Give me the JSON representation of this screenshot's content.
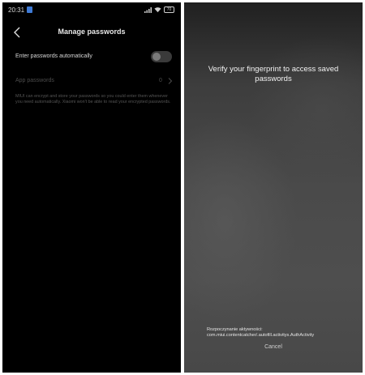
{
  "status_bar": {
    "time": "20:31",
    "battery": "70"
  },
  "manage": {
    "title": "Manage passwords",
    "auto_fill_label": "Enter passwords automatically",
    "auto_fill_enabled": false,
    "app_passwords_label": "App passwords",
    "app_passwords_count": "0",
    "description": "MIUI can encrypt and store your passwords so you could enter them whenever you need automatically. Xiaomi won't be able to read your encrypted passwords."
  },
  "auth": {
    "title": "Verify your fingerprint to access saved passwords",
    "activity_line1": "Rozpoczynanie aktywności:",
    "activity_line2": "com.miui.contentcatcher/.autofill.activitys.AuthActivity",
    "cancel_label": "Cancel"
  },
  "icons": {
    "back": "chevron-left-icon",
    "notification": "notification-badge-icon",
    "signal": "signal-icon",
    "wifi": "wifi-icon",
    "battery": "battery-icon",
    "chevron": "chevron-right-icon"
  },
  "colors": {
    "background_dark": "#000000",
    "text_primary": "#e8e8e8",
    "text_disabled": "#4c4c4c",
    "toggle_track": "#3a3a3a",
    "notification_badge": "#3f7bd6"
  }
}
